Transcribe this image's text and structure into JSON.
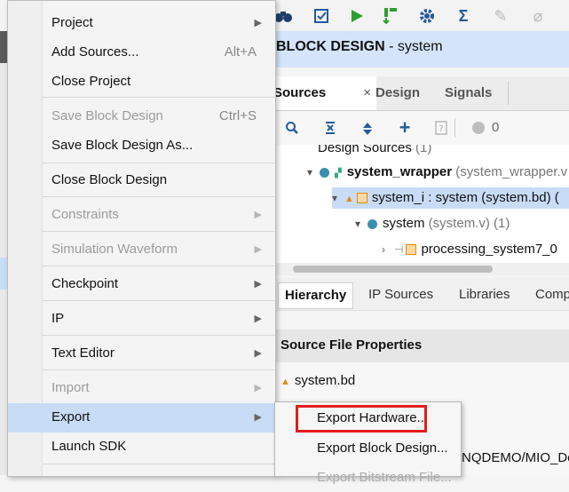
{
  "app": {
    "block_design_title": "BLOCK DESIGN",
    "block_design_suffix": " - system",
    "toolbar_icons": [
      "binoculars-icon",
      "checkbox-icon",
      "run-icon",
      "program-icon",
      "settings-icon",
      "sigma-icon",
      "debug-icon",
      "probe-icon"
    ]
  },
  "sources_panel": {
    "tabs": [
      "Sources",
      "Design",
      "Signals"
    ],
    "close_label": "×",
    "toolbar": {
      "count": "0"
    },
    "tree": [
      {
        "text": "Design Sources",
        "muted": " (1)"
      },
      {
        "text": "system_wrapper",
        "muted": " (system_wrapper.v"
      },
      {
        "text": "system_i : system (system.bd) (",
        "muted": ""
      },
      {
        "text": "system",
        "muted": " (system.v) (1)"
      },
      {
        "text": "processing_system7_0",
        "muted": ""
      }
    ],
    "bottom_tabs": [
      "Hierarchy",
      "IP Sources",
      "Libraries",
      "Comp"
    ]
  },
  "source_file_properties": {
    "title": "Source File Properties",
    "file": "system.bd",
    "path_fragment": "YNQDEMO/MIO_De"
  },
  "file_menu": {
    "items": [
      {
        "label": "Project",
        "arrow": "▶",
        "disabled": false
      },
      {
        "label": "Add Sources...",
        "shortcut": "Alt+A",
        "disabled": false
      },
      {
        "label": "Close Project",
        "disabled": false
      },
      {
        "label": "Save Block Design",
        "shortcut": "Ctrl+S",
        "disabled": true
      },
      {
        "label": "Save Block Design As...",
        "disabled": false
      },
      {
        "label": "Close Block Design",
        "disabled": false
      },
      {
        "label": "Constraints",
        "arrow": "▶",
        "disabled": true
      },
      {
        "label": "Simulation Waveform",
        "arrow": "▶",
        "disabled": true
      },
      {
        "label": "Checkpoint",
        "arrow": "▶",
        "disabled": false
      },
      {
        "label": "IP",
        "arrow": "▶",
        "disabled": false
      },
      {
        "label": "Text Editor",
        "arrow": "▶",
        "disabled": false
      },
      {
        "label": "Import",
        "arrow": "▶",
        "disabled": true
      },
      {
        "label": "Export",
        "arrow": "▶",
        "disabled": false,
        "highlighted": true
      },
      {
        "label": "Launch SDK",
        "disabled": false
      }
    ]
  },
  "export_submenu": {
    "items": [
      {
        "label": "Export Hardware...",
        "disabled": false,
        "callout": true
      },
      {
        "label": "Export Block Design...",
        "disabled": false
      },
      {
        "label": "Export Bitstream File...",
        "disabled": true
      }
    ]
  }
}
